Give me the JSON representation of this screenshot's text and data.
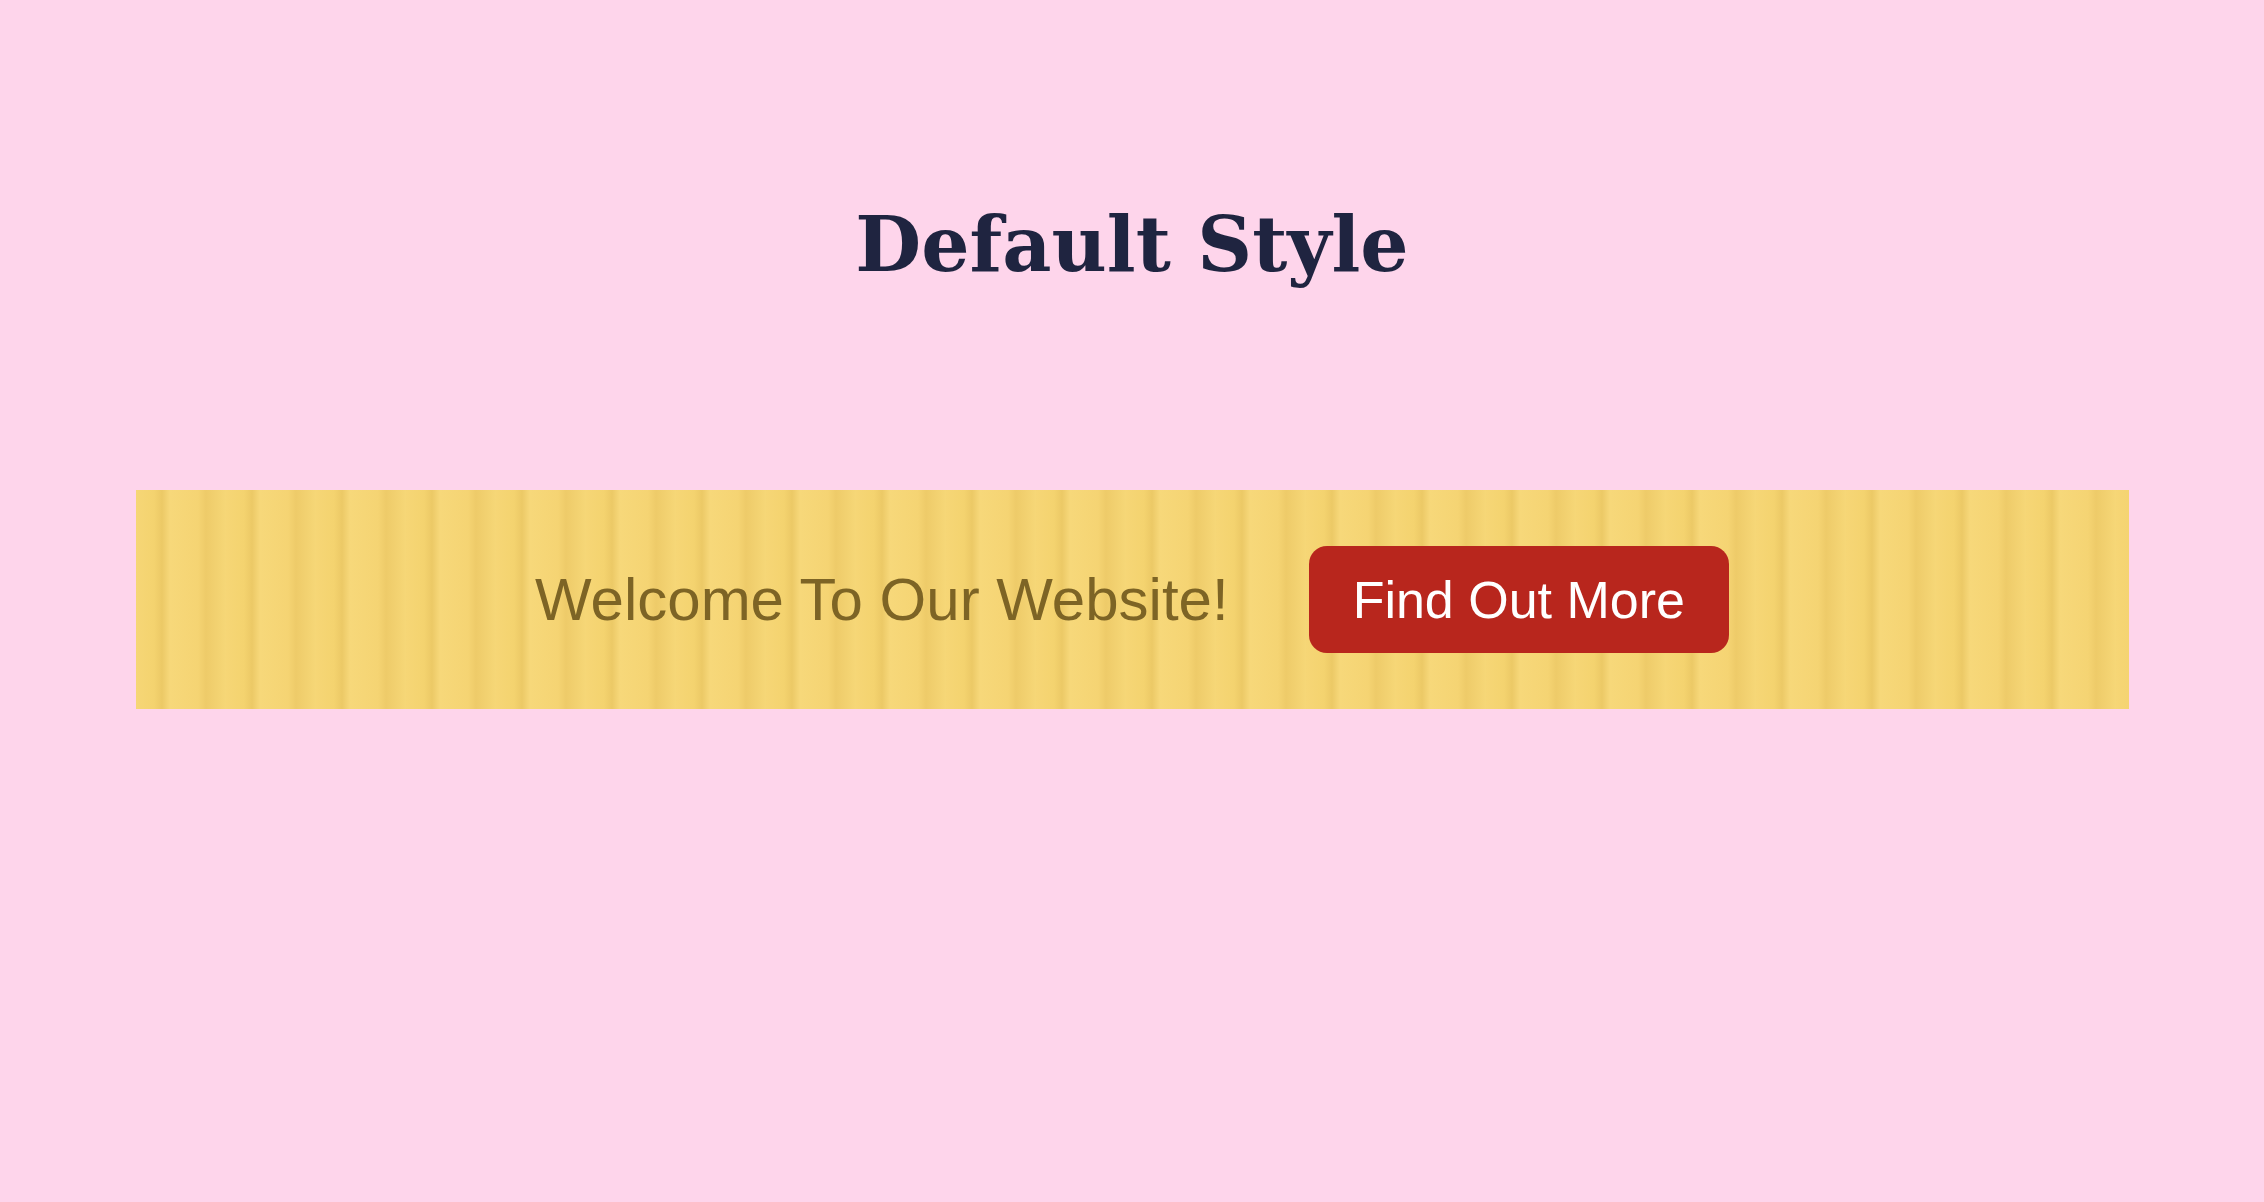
{
  "heading": "Default Style",
  "banner": {
    "kind": "picture",
    "message": "Welcome To Our Website!",
    "button": "Find Out More"
  }
}
